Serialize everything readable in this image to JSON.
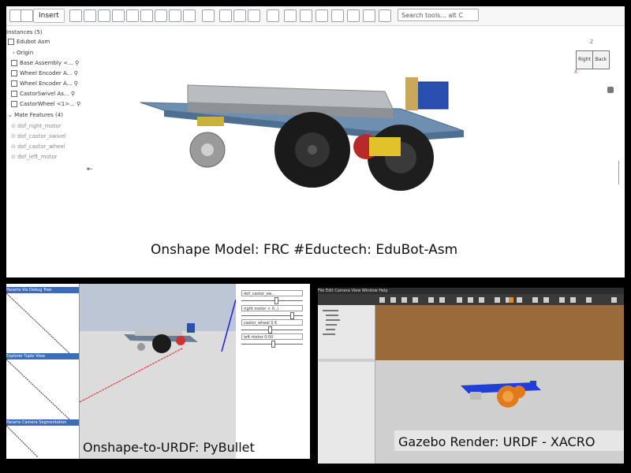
{
  "onshape": {
    "toolbar": {
      "insert_label": "Insert",
      "search_placeholder": "Search tools... alt C"
    },
    "feature_tree": {
      "instances_header": "Instances (5)",
      "root": "Edubot Asm",
      "items": [
        "Origin",
        "Base Assembly <...",
        "Wheel Encoder A...",
        "Wheel Encoder A...",
        "CastorSwivel As...",
        "CastorWheel <1>..."
      ],
      "mate_header": "Mate Features (4)",
      "mates": [
        "dof_right_motor",
        "dof_castor_swivel",
        "dof_castor_wheel",
        "dof_left_motor"
      ]
    },
    "view_cube": {
      "axis_z": "Z",
      "face_right": "Right",
      "face_back": "Back",
      "axis_x": "X"
    },
    "caption": "Onshape Model: FRC #Eductech: EduBot-Asm"
  },
  "pybullet": {
    "left_bars": [
      "Params Vis Debug Tree",
      "Explorer Tuple View",
      "Params Camera Segmentation"
    ],
    "controls": [
      {
        "label": "dof_castor_sw..",
        "value": 0.55
      },
      {
        "label": "right motor < 0..)",
        "value": 0.8
      },
      {
        "label": "castor_wheel 0 K",
        "value": 0.45
      },
      {
        "label": "left motor 0.00",
        "value": 0.5
      }
    ],
    "caption": "Onshape-to-URDF: PyBullet"
  },
  "gazebo": {
    "menu": "File  Edit  Camera  View  Window  Help",
    "caption": "Gazebo Render: URDF - XACRO"
  }
}
